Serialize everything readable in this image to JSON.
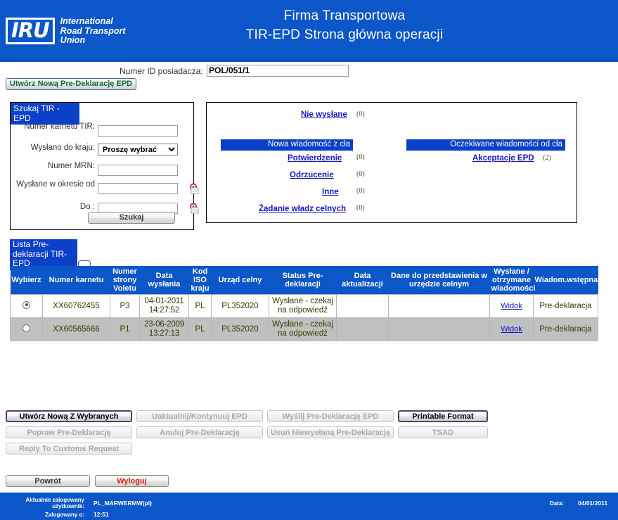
{
  "header": {
    "logo_main": "IRU",
    "logo_sub_line1": "International",
    "logo_sub_line2": "Road Transport",
    "logo_sub_line3": "Union",
    "title_line1": "Firma Transportowa",
    "title_line2": "TIR-EPD Strona główna operacji"
  },
  "holder": {
    "label": "Numer ID posiadacza:",
    "value": "POL/051/1",
    "create_button": "Utwórz Nową Pre-Deklarację EPD"
  },
  "search": {
    "title": "Szukaj TIR - EPD",
    "fields": [
      {
        "label": "Numer karnetu TIR:",
        "value": "",
        "type": "text"
      },
      {
        "label": "Wysłano do kraju:",
        "value": "Proszę wybrać",
        "type": "select"
      },
      {
        "label": "Numer MRN:",
        "value": "",
        "type": "text"
      },
      {
        "label": "Wysłane w okresie od",
        "value": "",
        "type": "date"
      },
      {
        "label": "Do :",
        "value": "",
        "type": "date"
      }
    ],
    "select_options": [
      "Proszę wybrać"
    ],
    "submit_label": "Szukaj"
  },
  "messages": {
    "not_sent_link": "Nie wysłane",
    "not_sent_count": "(0)",
    "new_from_customs_bar": "Nowa wiadomość z cła",
    "expected_from_customs_bar": "Oczekiwane wiadomości od cła",
    "left_items": [
      {
        "label": "Potwierdzenie",
        "count": "(0)"
      },
      {
        "label": "Odrzucenie",
        "count": "(0)"
      },
      {
        "label": "Inne",
        "count": "(0)"
      },
      {
        "label": "Żądanie władz celnych",
        "count": "(0)"
      }
    ],
    "right_items": [
      {
        "label": "Akceptacje EPD",
        "count": "(2)"
      }
    ]
  },
  "list": {
    "title": "Lista Pre-deklaracji TIR-EPD",
    "columns": [
      "Wybierz",
      "Numer karnetu",
      "Numer strony Voletu",
      "Data wysłania",
      "Kod ISO kraju",
      "Urząd celny",
      "Status Pre-deklaracji",
      "Data aktualizacji",
      "Dane do przedstawienia w urzędzie celnym",
      "Wysłane / otrzymane wiadomości",
      "Wiadom.wstępna"
    ],
    "rows": [
      {
        "selected": true,
        "carnet": "XX60762455",
        "volet": "P3",
        "sent_date": "04-01-2011 14:27:52",
        "iso": "PL",
        "office": "PL352020",
        "status": "Wysłane - czekaj na odpowiedź",
        "update_date": "",
        "data_for_office": "",
        "messages_link": "Widok",
        "pre_message": "Pre-deklaracja"
      },
      {
        "selected": false,
        "carnet": "XX60565666",
        "volet": "P1",
        "sent_date": "23-06-2009 13:27:13",
        "iso": "PL",
        "office": "PL352020",
        "status": "Wysłane - czekaj na odpowiedź",
        "update_date": "",
        "data_for_office": "",
        "messages_link": "Widok",
        "pre_message": "Pre-deklaracja"
      }
    ]
  },
  "actions": {
    "row1": [
      {
        "label": "Utwórz Nową Z Wybranych",
        "state": "primary"
      },
      {
        "label": "Uaktualnij/Kontynuuj EPD",
        "state": "disabled"
      },
      {
        "label": "Wyślij Pre-Deklarację EPD",
        "state": "disabled"
      },
      {
        "label": "Printable Format",
        "state": "primary"
      }
    ],
    "row2": [
      {
        "label": "Popraw Pre-Deklarację",
        "state": "disabled"
      },
      {
        "label": "Anuluj Pre-Deklarację",
        "state": "disabled"
      },
      {
        "label": "Usuń Niewysłaną Pre-Deklarację",
        "state": "disabled"
      },
      {
        "label": "TSAD",
        "state": "disabled"
      }
    ],
    "row3": [
      {
        "label": "Reply To Customs Request",
        "state": "disabled"
      }
    ]
  },
  "bottom": {
    "back_label": "Powrót",
    "logout_label": "Wyloguj"
  },
  "footer": {
    "user_label": "Aktualnie zalogowany użytkownik:",
    "user_value": "PL_MARWERMW(pl)",
    "login_time_label": "Zalogowany o:",
    "login_time_value": "12:51",
    "date_label": "Data:",
    "date_value": "04/01/2011"
  },
  "colors": {
    "header_blue": "#0b57c9",
    "panel_blue": "#0b41c9",
    "link_blue": "#1515c7",
    "row_alt": "#c0c0c0",
    "green_text": "#046b2a",
    "red_text": "#e01b10"
  }
}
